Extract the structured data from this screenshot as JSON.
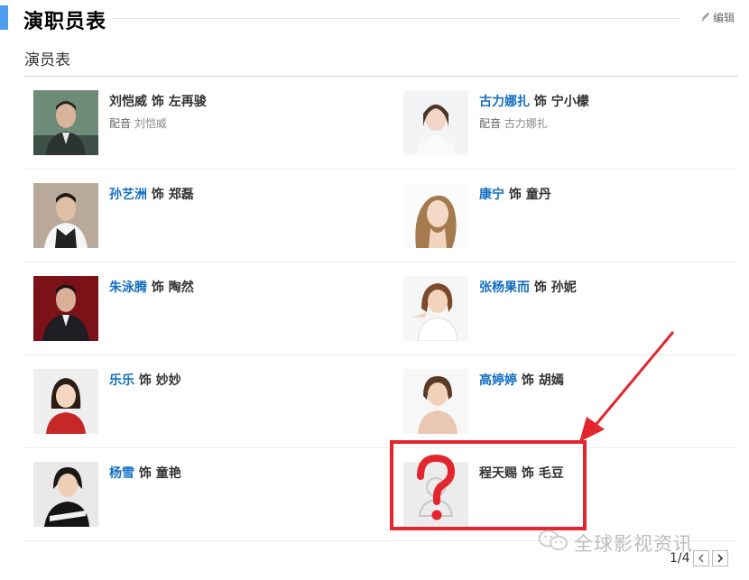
{
  "header": {
    "title": "演职员表",
    "edit_label": "编辑"
  },
  "subsection": {
    "title": "演员表"
  },
  "role_connector": "饰",
  "dub_label": "配音",
  "cast": [
    {
      "actor": "刘恺威",
      "role": "左再骏",
      "dub": "刘恺威",
      "photo": "man-suit-green-bg"
    },
    {
      "actor": "古力娜扎",
      "role": "宁小檬",
      "dub": "古力娜扎",
      "photo": "woman-white"
    },
    {
      "actor": "孙艺洲",
      "role": "郑磊",
      "dub": "",
      "photo": "man-vest"
    },
    {
      "actor": "康宁",
      "role": "童丹",
      "dub": "",
      "photo": "woman-long-hair"
    },
    {
      "actor": "朱泳腾",
      "role": "陶然",
      "dub": "",
      "photo": "man-red-bg"
    },
    {
      "actor": "张杨果而",
      "role": "孙妮",
      "dub": "",
      "photo": "woman-pose"
    },
    {
      "actor": "乐乐",
      "role": "妙妙",
      "dub": "",
      "photo": "child-red"
    },
    {
      "actor": "高婷婷",
      "role": "胡嫣",
      "dub": "",
      "photo": "woman-short-hair"
    },
    {
      "actor": "杨雪",
      "role": "童艳",
      "dub": "",
      "photo": "woman-black-white"
    },
    {
      "actor": "程天赐",
      "role": "毛豆",
      "dub": "",
      "photo": "placeholder-unknown"
    }
  ],
  "pagination": {
    "current": "1/4"
  },
  "watermark": {
    "text": "全球影视资讯"
  },
  "colors": {
    "accent": "#4f9cee",
    "link": "#136ec2",
    "highlight": "#e3262d"
  }
}
